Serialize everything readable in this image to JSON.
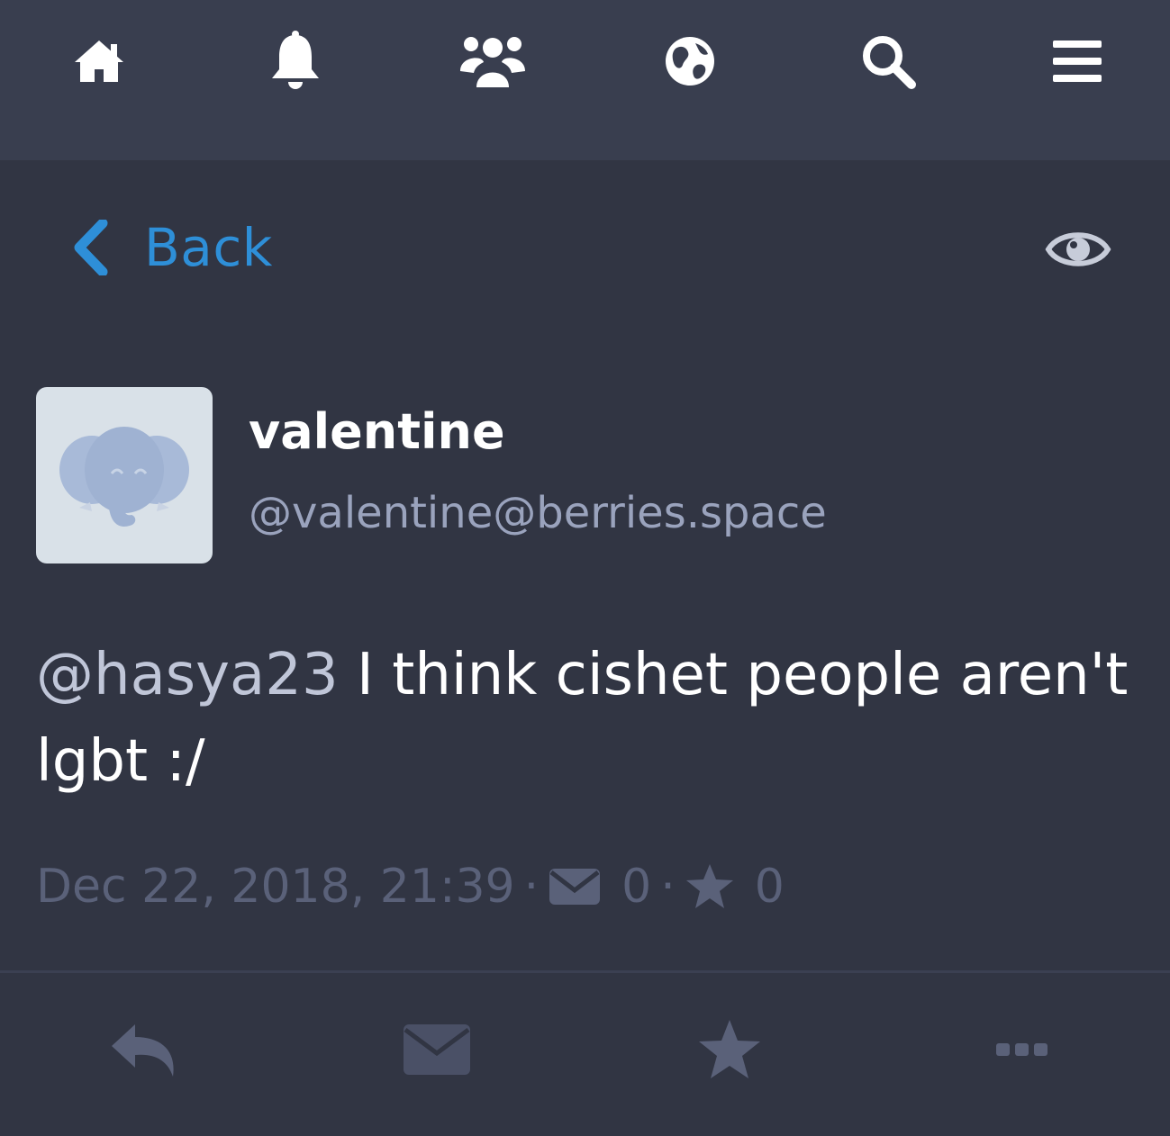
{
  "top_nav": {
    "icons": [
      "home-icon",
      "bell-icon",
      "users-icon",
      "globe-icon",
      "search-icon",
      "menu-icon"
    ]
  },
  "back": {
    "label": "Back"
  },
  "status": {
    "display_name": "valentine",
    "account": "@valentine@berries.space",
    "mention": "@hasya23",
    "text": " I think cishet people aren't lgbt :/",
    "timestamp": "Dec 22, 2018, 21:39",
    "separator": "·",
    "boost_count": "0",
    "favourite_count": "0"
  },
  "colors": {
    "background": "#313543",
    "nav_background": "#393e4f",
    "accent": "#2e8fd8",
    "muted": "#5a6179"
  }
}
